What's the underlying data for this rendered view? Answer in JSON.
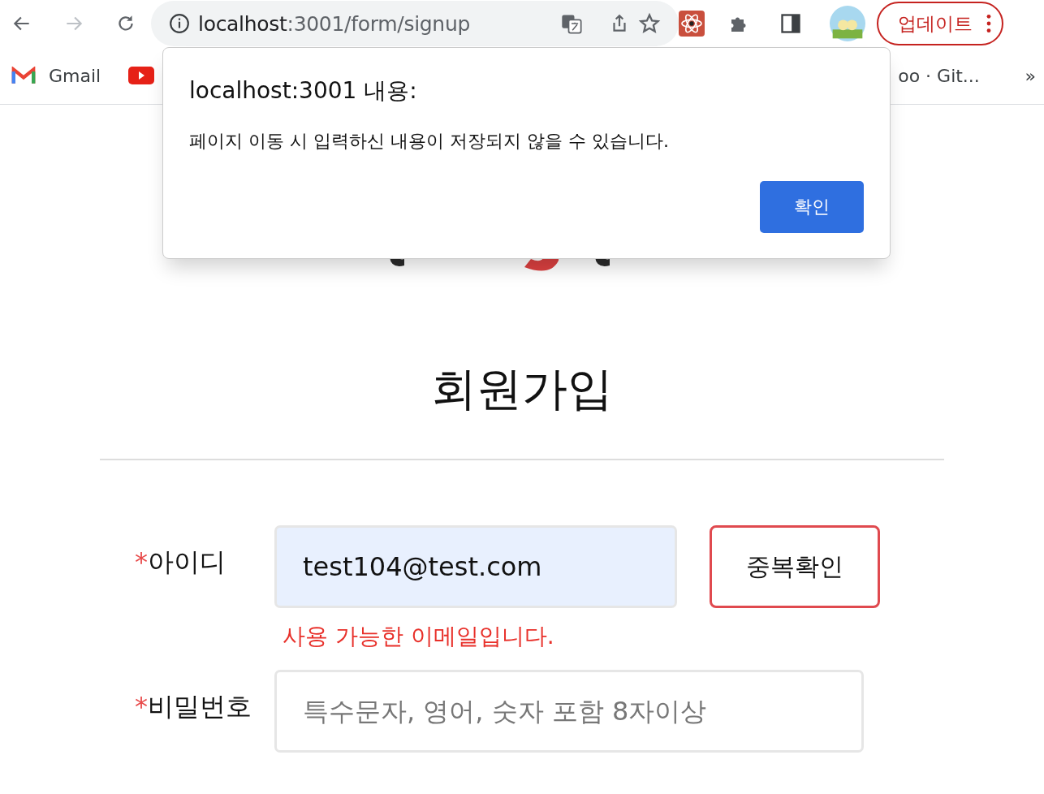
{
  "browser": {
    "url_host": "localhost",
    "url_path": ":3001/form/signup",
    "forward": {
      "disabled": true
    },
    "update_button": "업데이트",
    "bookmarks": [
      {
        "kind": "gmail",
        "label": "Gmail"
      },
      {
        "kind": "youtube"
      },
      {
        "kind": "text",
        "label": "oo · Git..."
      }
    ],
    "more_bookmarks": "»"
  },
  "dialog": {
    "title": "localhost:3001 내용:",
    "message": "페이지 이동 시 입력하신 내용이 저장되지 않을 수 있습니다.",
    "ok_button": "확인"
  },
  "page": {
    "title": "회원가입",
    "fields": [
      {
        "required_mark": "*",
        "label": "아이디",
        "value": "test104@test.com",
        "autofilled": true,
        "button": "중복확인",
        "message": "사용 가능한 이메일입니다."
      },
      {
        "required_mark": "*",
        "label": "비밀번호",
        "placeholder": "특수문자, 영어, 숫자 포함 8자이상",
        "autofilled": false
      }
    ]
  }
}
